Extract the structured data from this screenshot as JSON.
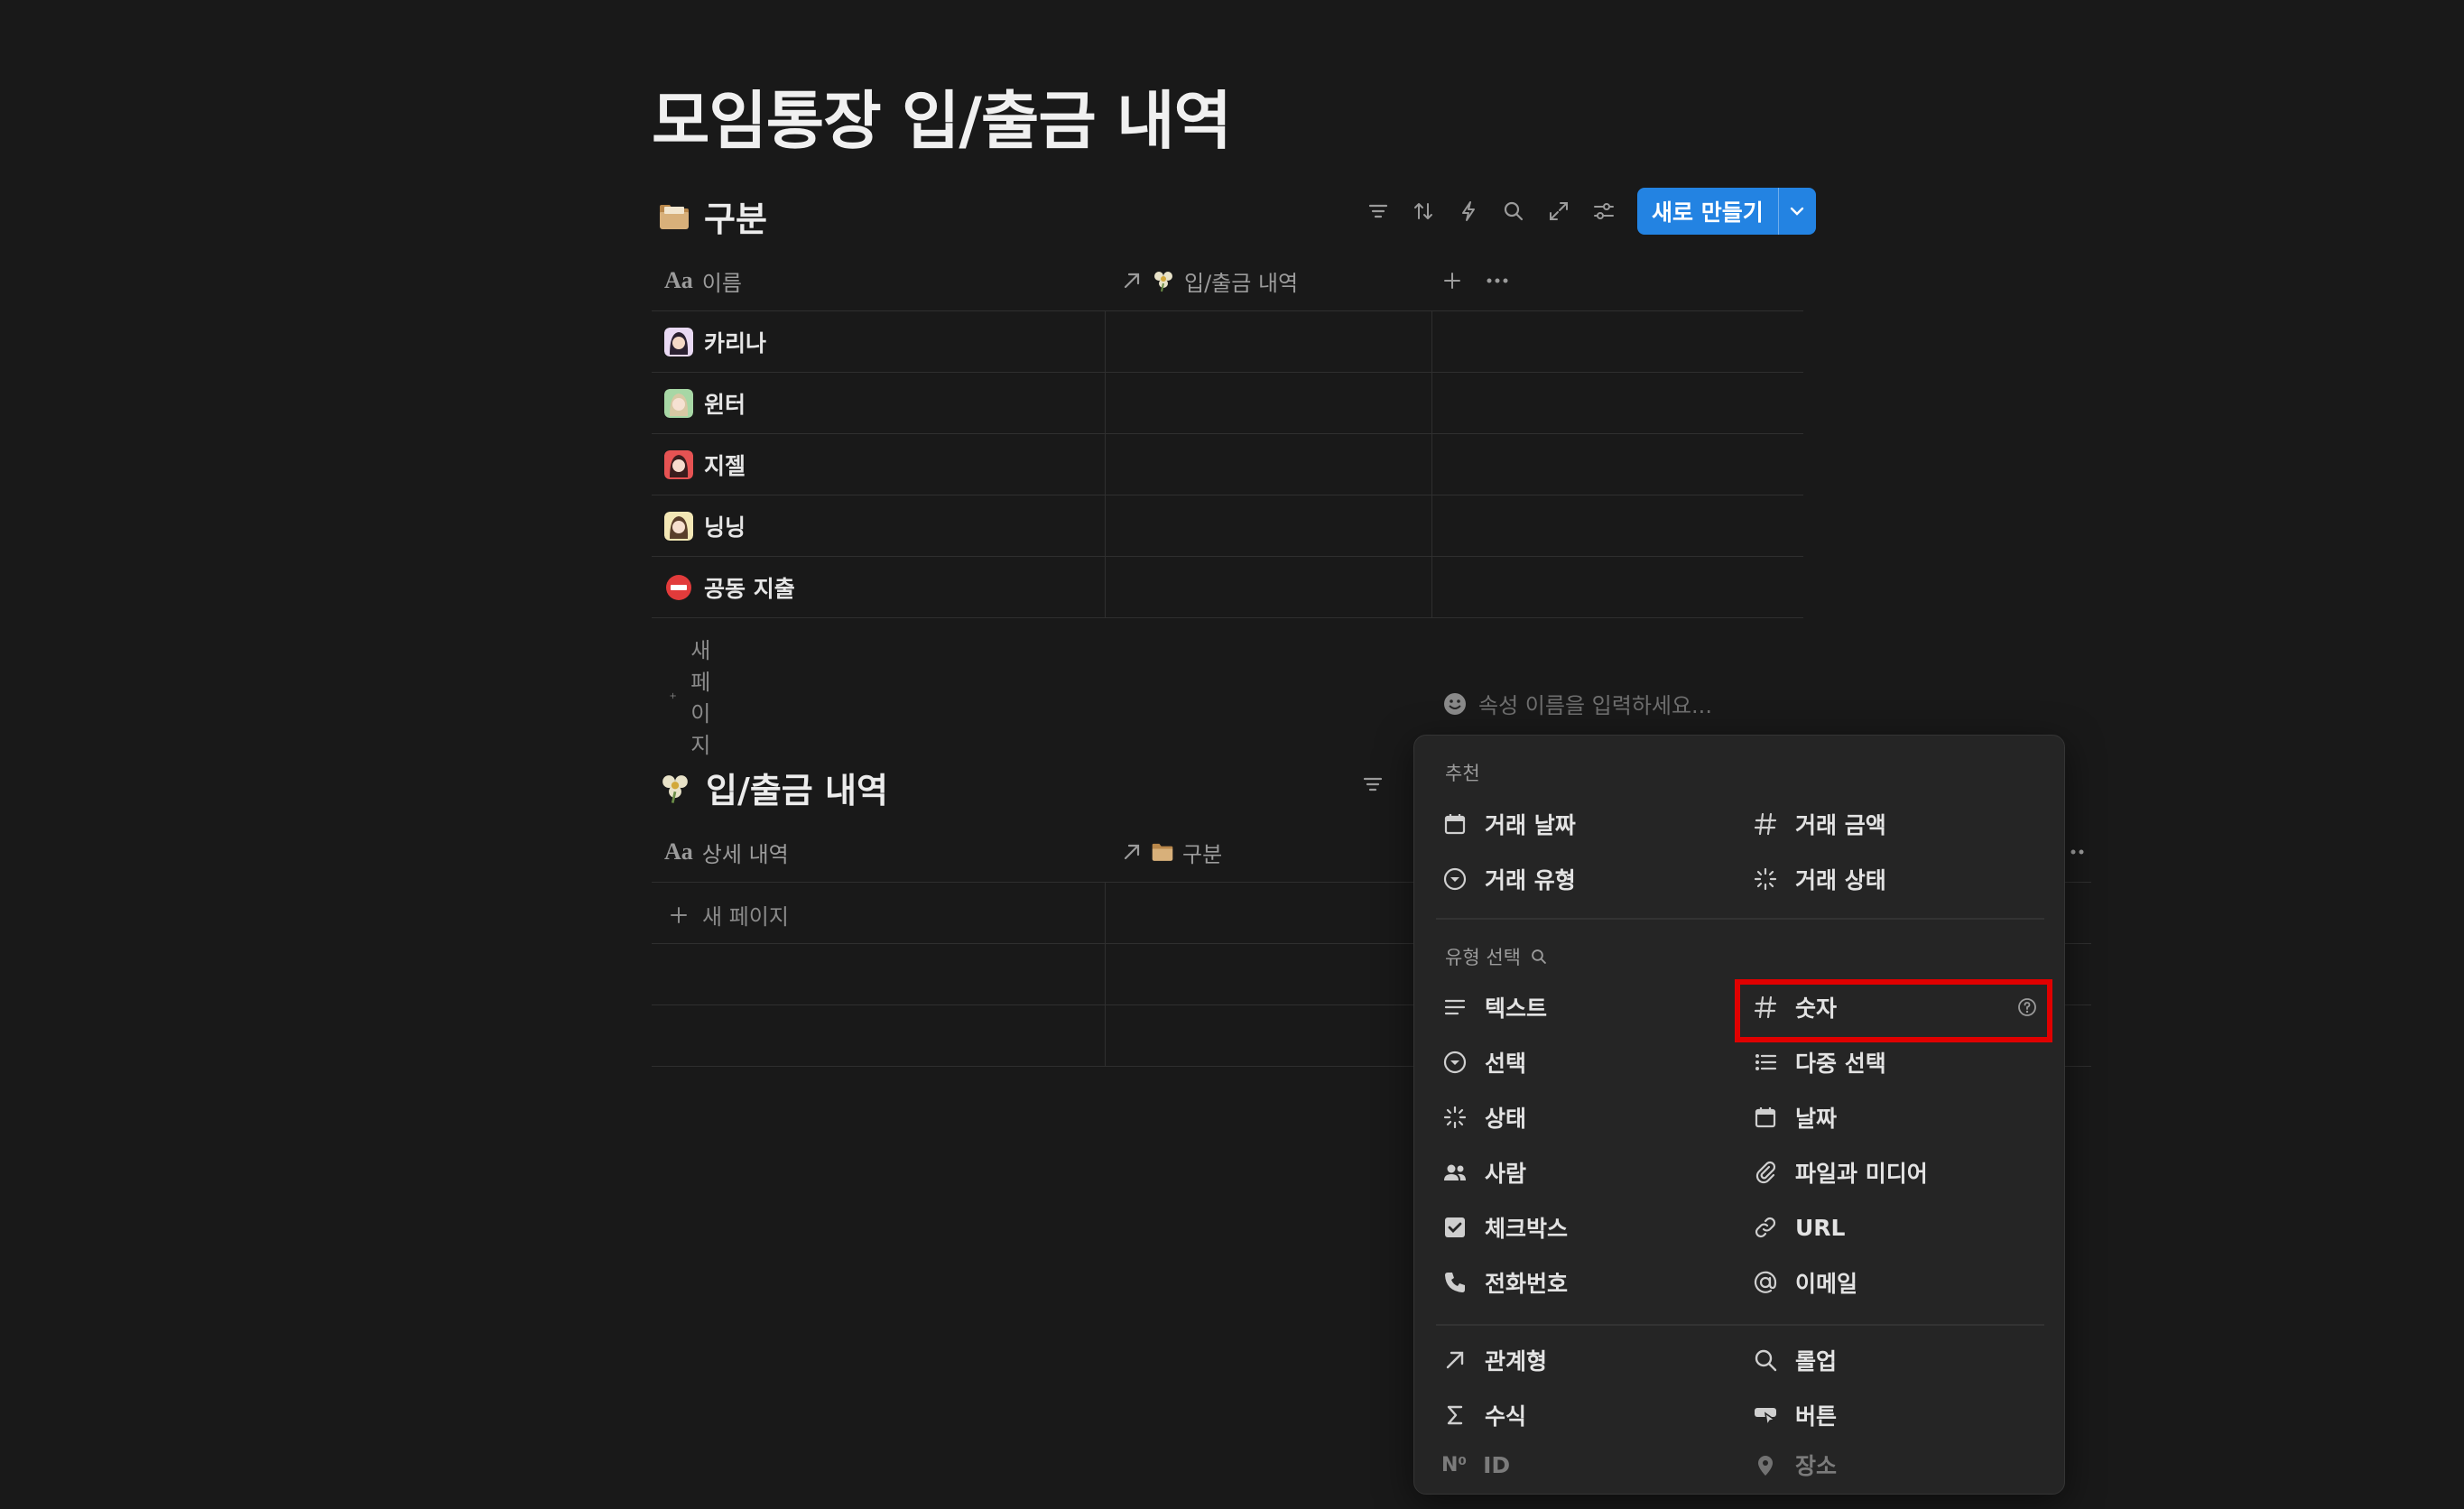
{
  "page": {
    "title": "모임통장 입/출금 내역"
  },
  "db1": {
    "title": "구분",
    "toolbar": {
      "icons": [
        "filter-icon",
        "sort-icon",
        "automation-icon",
        "search-icon",
        "expand-icon",
        "settings-icon"
      ],
      "new_button": "새로 만들기"
    },
    "columns": [
      {
        "label": "이름",
        "icon": "text-type-icon"
      },
      {
        "label": "입/출금 내역",
        "icon": "relation-icon"
      }
    ],
    "rows": [
      {
        "name": "카리나"
      },
      {
        "name": "윈터"
      },
      {
        "name": "지젤"
      },
      {
        "name": "닝닝"
      },
      {
        "name": "공동 지출"
      }
    ],
    "new_page": "새 페이지"
  },
  "db2": {
    "title": "입/출금 내역",
    "columns": [
      {
        "label": "상세 내역",
        "icon": "text-type-icon"
      },
      {
        "label": "구분",
        "icon": "relation-icon"
      }
    ],
    "new_page": "새 페이지"
  },
  "property_input": {
    "placeholder": "속성 이름을 입력하세요..."
  },
  "menu": {
    "suggested_label": "추천",
    "suggested": [
      {
        "label": "거래 날짜",
        "icon": "calendar-icon"
      },
      {
        "label": "거래 금액",
        "icon": "number-icon"
      },
      {
        "label": "거래 유형",
        "icon": "select-icon"
      },
      {
        "label": "거래 상태",
        "icon": "status-icon"
      }
    ],
    "types_label": "유형 선택",
    "types": [
      {
        "label": "텍스트",
        "icon": "text-icon"
      },
      {
        "label": "숫자",
        "icon": "number-icon"
      },
      {
        "label": "선택",
        "icon": "select-icon"
      },
      {
        "label": "다중 선택",
        "icon": "multi-select-icon"
      },
      {
        "label": "상태",
        "icon": "status-icon"
      },
      {
        "label": "날짜",
        "icon": "calendar-icon"
      },
      {
        "label": "사람",
        "icon": "people-icon"
      },
      {
        "label": "파일과 미디어",
        "icon": "paperclip-icon"
      },
      {
        "label": "체크박스",
        "icon": "checkbox-icon"
      },
      {
        "label": "URL",
        "icon": "link-icon"
      },
      {
        "label": "전화번호",
        "icon": "phone-icon"
      },
      {
        "label": "이메일",
        "icon": "at-icon"
      }
    ],
    "advanced": [
      {
        "label": "관계형",
        "icon": "relation-icon"
      },
      {
        "label": "롤업",
        "icon": "rollup-icon"
      },
      {
        "label": "수식",
        "icon": "sigma-icon"
      },
      {
        "label": "버튼",
        "icon": "button-icon"
      },
      {
        "label": "ID",
        "icon": "id-icon",
        "id_prefix": "N⁰"
      },
      {
        "label": "장소",
        "icon": "pin-icon"
      }
    ]
  },
  "colors": {
    "background": "#191919",
    "accent": "#2383e2",
    "highlight": "#e00000"
  }
}
